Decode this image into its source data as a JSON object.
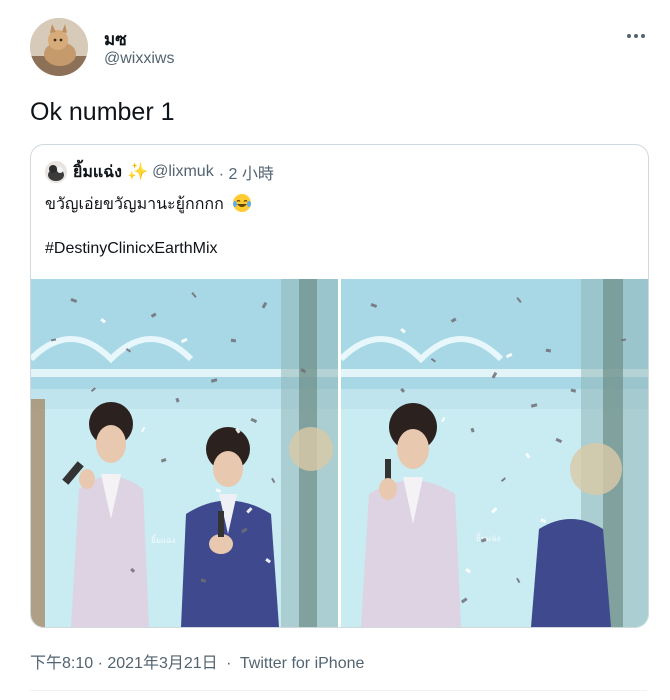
{
  "tweet": {
    "author_name": "มซ",
    "author_handle": "@wixxiws",
    "text": "Ok number 1",
    "timestamp": "下午8:10 · 2021年3月21日",
    "separator": "·",
    "source": "Twitter for iPhone"
  },
  "quote": {
    "author_name": "ยิ้มแฉ่ง",
    "sparkle": "✨",
    "author_handle": "@lixmuk",
    "time": "· 2 小時",
    "text": "ขวัญเอ่ยขวัญมานะยู้กกกก",
    "emoji": "face-with-tears-of-joy",
    "hashtag": "#DestinyClinicxEarthMix",
    "watermark_left": "ยิ้มแฉ่ง",
    "watermark_right": "ยิ้มแฉ่ง"
  },
  "colors": {
    "text_primary": "#0f1419",
    "text_secondary": "#536471",
    "border": "#cfd9de",
    "photo_bg": "#bfe4ee"
  }
}
